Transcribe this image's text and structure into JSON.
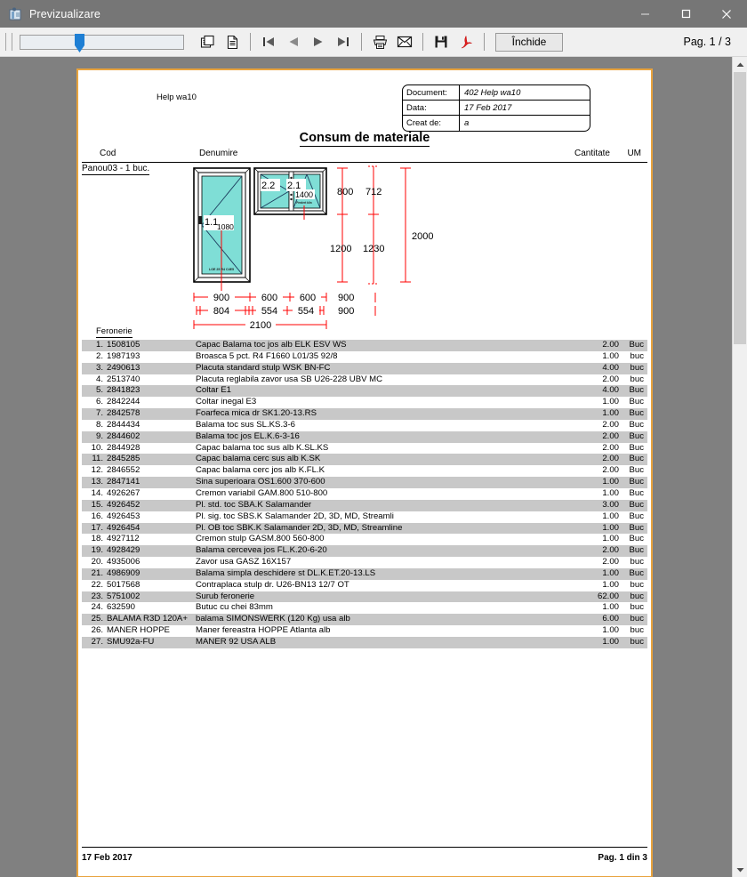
{
  "window": {
    "title": "Previzualizare",
    "icon": "app-preview-icon",
    "minimize_label": "—",
    "maximize_label": "□",
    "close_label": "✕"
  },
  "toolbar": {
    "zoom_value": 33,
    "buttons": [
      {
        "name": "page-view-icon",
        "title": "Vizualizare pagina"
      },
      {
        "name": "document-icon",
        "title": "Document"
      },
      {
        "name": "first-page-icon",
        "title": "Prima pagina"
      },
      {
        "name": "prev-page-icon",
        "title": "Pagina anterioara"
      },
      {
        "name": "next-page-icon",
        "title": "Pagina urmatoare"
      },
      {
        "name": "last-page-icon",
        "title": "Ultima pagina"
      },
      {
        "name": "print-icon",
        "title": "Tiparire"
      },
      {
        "name": "email-icon",
        "title": "Email"
      },
      {
        "name": "save-icon",
        "title": "Salvare"
      },
      {
        "name": "pdf-icon",
        "title": "Export PDF"
      }
    ],
    "close_label": "Închide",
    "page_indicator": "Pag. 1 / 3"
  },
  "document": {
    "top_left_label": "Help wa10",
    "info": [
      {
        "label": "Document:",
        "value": "402 Help wa10"
      },
      {
        "label": "Data:",
        "value": "17 Feb 2017"
      },
      {
        "label": "Creat de:",
        "value": "a"
      }
    ],
    "title": "Consum de materiale",
    "columns": {
      "cod": "Cod",
      "denumire": "Denumire",
      "cantitate": "Cantitate",
      "um": "UM"
    },
    "panel_label": "Panou03 - 1 buc.",
    "section_title": "Feronerie",
    "footer_left": "17 Feb 2017",
    "footer_right": "Pag. 1 din 3"
  },
  "drawing": {
    "sash_labels": [
      "1.1",
      "2.2",
      "2.1"
    ],
    "glass_labels": [
      "1080",
      "1400"
    ],
    "door_stamp": "LOE 25 R4 C4E5",
    "small_stamp": "Ferdert klin",
    "vertical_dims": [
      "800",
      "712",
      "1200",
      "1230",
      "2000"
    ],
    "horizontal_dims_row1": [
      "900",
      "600",
      "600"
    ],
    "horizontal_dims_row2": [
      "804",
      "554",
      "554"
    ],
    "horizontal_total": "2100",
    "side_dims": [
      "900",
      "900"
    ],
    "glass_color": "#7fded6",
    "dim_color": "#ff0000"
  },
  "items": [
    {
      "no": "1.",
      "code": "1508105",
      "name": "Capac Balama toc jos alb ELK ESV WS",
      "qty": "2.00",
      "um": "Buc"
    },
    {
      "no": "2.",
      "code": "1987193",
      "name": "Broasca 5 pct. R4 F1660 L01/35 92/8",
      "qty": "1.00",
      "um": "buc"
    },
    {
      "no": "3.",
      "code": "2490613",
      "name": "Placuta standard stulp WSK BN-FC",
      "qty": "4.00",
      "um": "buc"
    },
    {
      "no": "4.",
      "code": "2513740",
      "name": "Placuta reglabila zavor usa SB U26-228 UBV MC",
      "qty": "2.00",
      "um": "buc"
    },
    {
      "no": "5.",
      "code": "2841823",
      "name": "Coltar E1",
      "qty": "4.00",
      "um": "Buc"
    },
    {
      "no": "6.",
      "code": "2842244",
      "name": "Coltar inegal E3",
      "qty": "1.00",
      "um": "Buc"
    },
    {
      "no": "7.",
      "code": "2842578",
      "name": "Foarfeca mica dr SK1.20-13.RS",
      "qty": "1.00",
      "um": "Buc"
    },
    {
      "no": "8.",
      "code": "2844434",
      "name": "Balama toc sus SL.KS.3-6",
      "qty": "2.00",
      "um": "Buc"
    },
    {
      "no": "9.",
      "code": "2844602",
      "name": "Balama toc jos EL.K.6-3-16",
      "qty": "2.00",
      "um": "Buc"
    },
    {
      "no": "10.",
      "code": "2844928",
      "name": "Capac balama toc sus alb K.SL.KS",
      "qty": "2.00",
      "um": "Buc"
    },
    {
      "no": "11.",
      "code": "2845285",
      "name": "Capac balama cerc sus alb K.SK",
      "qty": "2.00",
      "um": "Buc"
    },
    {
      "no": "12.",
      "code": "2846552",
      "name": "Capac balama cerc jos alb K.FL.K",
      "qty": "2.00",
      "um": "Buc"
    },
    {
      "no": "13.",
      "code": "2847141",
      "name": "Sina superioara OS1.600 370-600",
      "qty": "1.00",
      "um": "Buc"
    },
    {
      "no": "14.",
      "code": "4926267",
      "name": "Cremon variabil GAM.800 510-800",
      "qty": "1.00",
      "um": "Buc"
    },
    {
      "no": "15.",
      "code": "4926452",
      "name": "Pl. std. toc SBA.K Salamander",
      "qty": "3.00",
      "um": "Buc"
    },
    {
      "no": "16.",
      "code": "4926453",
      "name": "Pl. sig. toc SBS.K Salamander 2D, 3D, MD, Streamli",
      "qty": "1.00",
      "um": "Buc"
    },
    {
      "no": "17.",
      "code": "4926454",
      "name": "Pl. OB toc SBK.K Salamander 2D, 3D, MD, Streamline",
      "qty": "1.00",
      "um": "Buc"
    },
    {
      "no": "18.",
      "code": "4927112",
      "name": "Cremon stulp GASM.800 560-800",
      "qty": "1.00",
      "um": "Buc"
    },
    {
      "no": "19.",
      "code": "4928429",
      "name": "Balama cercevea jos FL.K.20-6-20",
      "qty": "2.00",
      "um": "Buc"
    },
    {
      "no": "20.",
      "code": "4935006",
      "name": "Zavor usa GASZ 16X157",
      "qty": "2.00",
      "um": "buc"
    },
    {
      "no": "21.",
      "code": "4986909",
      "name": "Balama simpla deschidere st DL.K.ET.20-13.LS",
      "qty": "1.00",
      "um": "Buc"
    },
    {
      "no": "22.",
      "code": "5017568",
      "name": "Contraplaca stulp dr. U26-BN13 12/7 OT",
      "qty": "1.00",
      "um": "buc"
    },
    {
      "no": "23.",
      "code": "5751002",
      "name": "Surub feronerie",
      "qty": "62.00",
      "um": "buc"
    },
    {
      "no": "24.",
      "code": "632590",
      "name": "Butuc cu chei 83mm",
      "qty": "1.00",
      "um": "buc"
    },
    {
      "no": "25.",
      "code": "BALAMA R3D 120A+",
      "name": "balama SIMONSWERK (120 Kg) usa  alb",
      "qty": "6.00",
      "um": "buc"
    },
    {
      "no": "26.",
      "code": "MANER HOPPE",
      "name": "Maner fereastra HOPPE Atlanta alb",
      "qty": "1.00",
      "um": "buc"
    },
    {
      "no": "27.",
      "code": "SMU92a-FU",
      "name": "MANER 92 USA ALB",
      "qty": "1.00",
      "um": "buc"
    }
  ]
}
